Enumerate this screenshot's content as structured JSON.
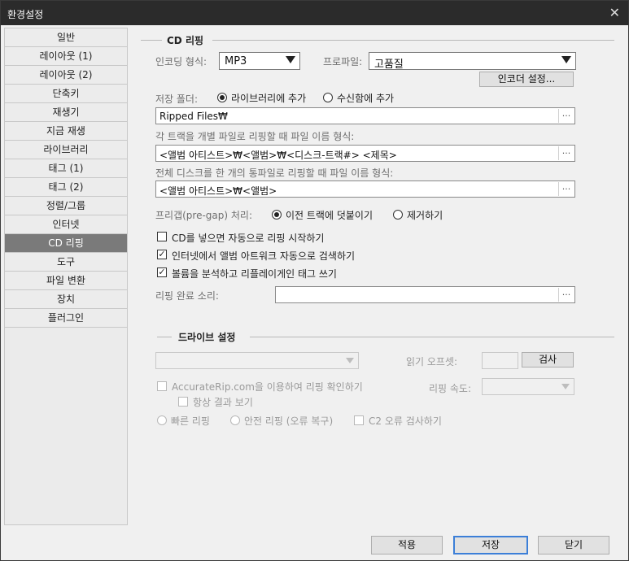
{
  "window": {
    "title": "환경설정",
    "close_glyph": "✕"
  },
  "sidebar": {
    "items": [
      {
        "label": "일반"
      },
      {
        "label": "레이아웃 (1)"
      },
      {
        "label": "레이아웃 (2)"
      },
      {
        "label": "단축키"
      },
      {
        "label": "재생기"
      },
      {
        "label": "지금 재생"
      },
      {
        "label": "라이브러리"
      },
      {
        "label": "태그 (1)"
      },
      {
        "label": "태그 (2)"
      },
      {
        "label": "정렬/그룹"
      },
      {
        "label": "인터넷"
      },
      {
        "label": "CD 리핑",
        "active": true
      },
      {
        "label": "도구"
      },
      {
        "label": "파일 변환"
      },
      {
        "label": "장치"
      },
      {
        "label": "플러그인"
      }
    ]
  },
  "cd_ripping": {
    "section_title": "CD 리핑",
    "encoding_label": "인코딩 형식:",
    "encoding_value": "MP3",
    "profile_label": "프로파일:",
    "profile_value": "고품질",
    "encoder_settings_button": "인코더 설정...",
    "save_folder_label": "저장 폴더:",
    "save_option_library": "라이브러리에 추가",
    "save_option_inbox": "수신함에 추가",
    "folder_value": "Ripped Files₩",
    "per_track_label": "각 트랙을 개별 파일로 리핑할 때 파일 이름 형식:",
    "per_track_value": "<앨범 아티스트>₩<앨범>₩<디스크-트랙#> <제목>",
    "whole_disc_label": "전체 디스크를 한 개의 통파일로 리핑할 때 파일 이름 형식:",
    "whole_disc_value": "<앨범 아티스트>₩<앨범>",
    "pregap_label": "프리갭(pre-gap) 처리:",
    "pregap_option_append": "이전 트랙에 덧붙이기",
    "pregap_option_remove": "제거하기",
    "auto_rip_label": "CD를 넣으면 자동으로 리핑 시작하기",
    "auto_rip_checked": false,
    "artwork_label": "인터넷에서 앨범 아트워크 자동으로 검색하기",
    "artwork_checked": true,
    "replaygain_label": "볼륨을 분석하고 리플레이게인 태그 쓰기",
    "replaygain_checked": true,
    "complete_sound_label": "리핑 완료 소리:",
    "complete_sound_value": "",
    "browse_glyph": "..."
  },
  "drive": {
    "section_title": "드라이브 설정",
    "drive_select_value": "",
    "read_offset_label": "읽기 오프셋:",
    "read_offset_value": "",
    "detect_button": "검사",
    "accuraterip_label": "AccurateRip.com을 이용하여 리핑 확인하기",
    "always_show_label": "항상 결과 보기",
    "rip_speed_label": "리핑 속도:",
    "rip_speed_value": "",
    "mode_fast": "빠른 리핑",
    "mode_secure": "안전 리핑 (오류 복구)",
    "c2_label": "C2 오류 검사하기"
  },
  "footer": {
    "apply": "적용",
    "save": "저장",
    "close": "닫기"
  },
  "colors": {
    "titlebar": "#2b2b2b",
    "active_item": "#7a7a7a",
    "accent": "#3c7fd8"
  }
}
